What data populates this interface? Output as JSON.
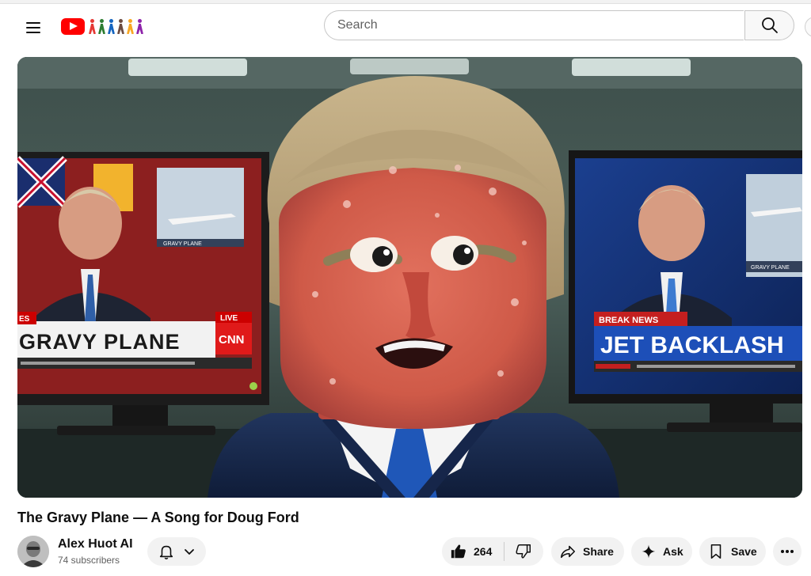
{
  "masthead": {
    "search_placeholder": "Search",
    "icons": [
      "menu-icon",
      "youtube-logo",
      "search-icon"
    ]
  },
  "video": {
    "title": "The Gravy Plane — A Song for Doug Ford",
    "thumbnail": {
      "left_screen": {
        "headline": "GRAVY PLANE",
        "badge": "LIVE",
        "network": "CNN",
        "corner_tag": "ES",
        "inset_caption": "GRAVY PLANE"
      },
      "right_screen": {
        "banner": "BREAK NEWS",
        "headline": "JET BACKLASH",
        "inset_caption": "GRAVY PLANE"
      }
    }
  },
  "owner": {
    "channel_name": "Alex Huot AI",
    "subscribers": "74 subscribers"
  },
  "actions": {
    "like_count": "264",
    "share_label": "Share",
    "ask_label": "Ask",
    "save_label": "Save"
  },
  "colors": {
    "brand_red": "#ff0000",
    "button_bg": "#f2f2f2",
    "text_primary": "#0f0f0f",
    "text_secondary": "#606060"
  }
}
